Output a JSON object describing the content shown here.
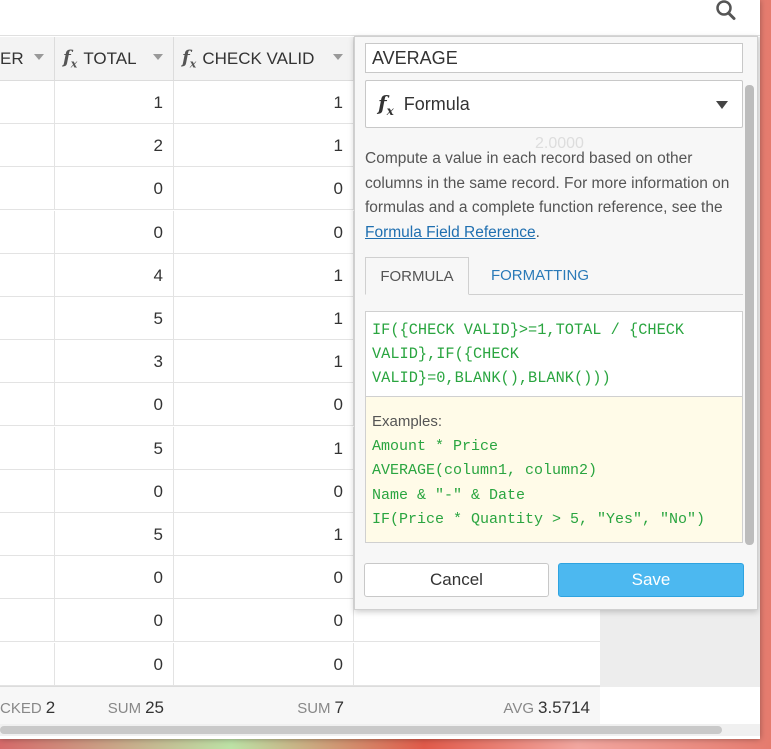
{
  "grid": {
    "columns": [
      {
        "label": "ER",
        "has_fx": false
      },
      {
        "label": "TOTAL",
        "has_fx": true
      },
      {
        "label": "CHECK VALID",
        "has_fx": true
      }
    ],
    "rows": [
      {
        "total": "1",
        "check_valid": "1"
      },
      {
        "total": "2",
        "check_valid": "1"
      },
      {
        "total": "0",
        "check_valid": "0"
      },
      {
        "total": "0",
        "check_valid": "0"
      },
      {
        "total": "4",
        "check_valid": "1"
      },
      {
        "total": "5",
        "check_valid": "1"
      },
      {
        "total": "3",
        "check_valid": "1"
      },
      {
        "total": "0",
        "check_valid": "0"
      },
      {
        "total": "5",
        "check_valid": "1"
      },
      {
        "total": "0",
        "check_valid": "0"
      },
      {
        "total": "5",
        "check_valid": "1"
      },
      {
        "total": "0",
        "check_valid": "0"
      },
      {
        "total": "0",
        "check_valid": "0"
      },
      {
        "total": "0",
        "check_valid": "0"
      }
    ],
    "footer": {
      "first_label": "CKED",
      "first_value": "2",
      "total_label": "SUM",
      "total_value": "25",
      "check_label": "SUM",
      "check_value": "7",
      "avg_label": "AVG",
      "avg_value": "3.5714"
    }
  },
  "panel": {
    "field_name": "AVERAGE",
    "field_type": "Formula",
    "ghost_value": "2.0000",
    "description": "Compute a value in each record based on other columns in the same record. For more information on formulas and a complete function reference, see the ",
    "description_link": "Formula Field Reference",
    "description_end": ".",
    "tabs": {
      "formula": "FORMULA",
      "formatting": "FORMATTING"
    },
    "formula_text": "IF({CHECK VALID}>=1,TOTAL / {CHECK VALID},IF({CHECK VALID}=0,BLANK(),BLANK()))",
    "examples_title": "Examples:",
    "examples": [
      "Amount * Price",
      "AVERAGE(column1, column2)",
      "Name & \"-\" & Date",
      "IF(Price * Quantity > 5, \"Yes\", \"No\")"
    ],
    "cancel_label": "Cancel",
    "save_label": "Save"
  },
  "colors": {
    "save_button": "#4cb8f0",
    "formula_green": "#2aa540",
    "link_blue": "#1f6fb0",
    "examples_bg": "#fffbe8"
  }
}
